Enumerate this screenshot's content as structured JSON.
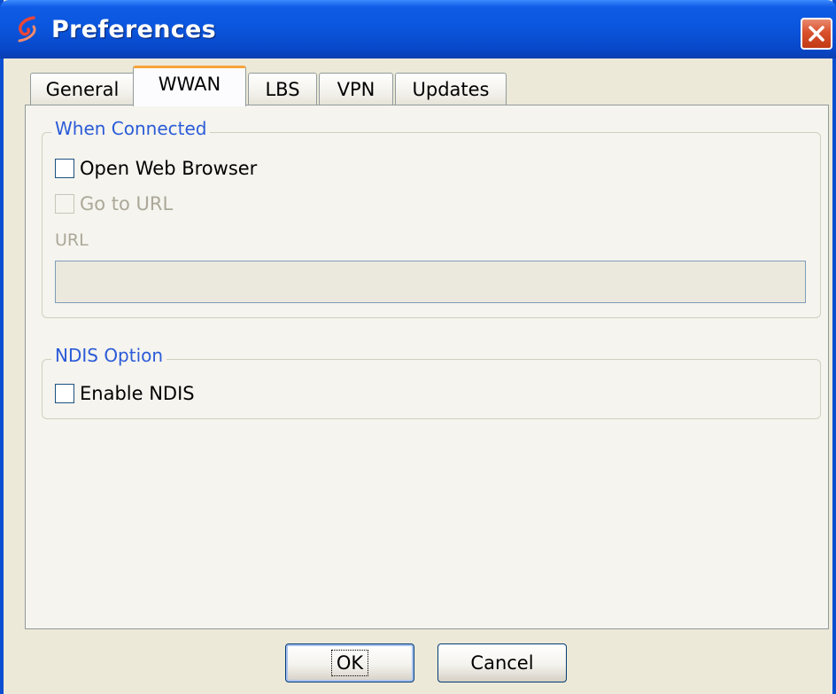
{
  "window": {
    "title": "Preferences",
    "icon": "app-swirl-icon",
    "close_icon": "close-icon"
  },
  "tabs": [
    {
      "label": "General",
      "active": false
    },
    {
      "label": "WWAN",
      "active": true
    },
    {
      "label": "LBS",
      "active": false
    },
    {
      "label": "VPN",
      "active": false
    },
    {
      "label": "Updates",
      "active": false
    }
  ],
  "when_connected": {
    "legend": "When Connected",
    "open_browser": {
      "label": "Open Web Browser",
      "checked": false
    },
    "go_to_url": {
      "label": "Go to URL",
      "checked": false,
      "disabled": true
    },
    "url_label": "URL",
    "url_value": ""
  },
  "ndis": {
    "legend": "NDIS Option",
    "enable": {
      "label": "Enable NDIS",
      "checked": false
    }
  },
  "buttons": {
    "ok": "OK",
    "cancel": "Cancel"
  },
  "colors": {
    "titlebar": "#0A55DC",
    "legend_text": "#2B5BD8",
    "active_tab_accent": "#F7A33B",
    "close_button": "#D9512C"
  }
}
